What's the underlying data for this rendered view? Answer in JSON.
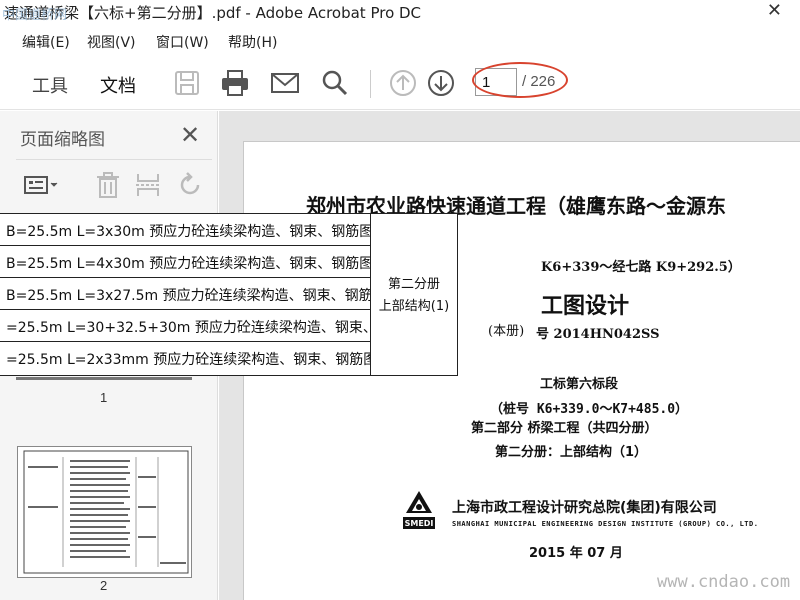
{
  "window": {
    "title": "速通道桥梁【六标+第二分册】.pdf - Adobe Acrobat Pro DC",
    "close_glyph": "✕"
  },
  "menu": [
    "编辑(E)",
    "视图(V)",
    "窗口(W)",
    "帮助(H)"
  ],
  "toolbar": {
    "tabs": [
      "工具",
      "文档"
    ],
    "active_tab": "文档",
    "page_current": "1",
    "page_total": "/ 226",
    "icons": [
      "save-icon",
      "print-icon",
      "email-icon",
      "search-icon",
      "prev-page-icon",
      "next-page-icon"
    ]
  },
  "sidebar": {
    "title": "页面缩略图",
    "close_glyph": "✕",
    "thumbnails": [
      {
        "label": "1"
      },
      {
        "label": "2"
      }
    ],
    "tools": [
      "thumbnail-options-icon",
      "delete-icon",
      "insert-icon",
      "rotate-icon"
    ]
  },
  "overlay_table": {
    "rows": [
      "B=25.5m L=3x30m  预应力砼连续梁构造、钢束、钢筋图",
      "B=25.5m L=4x30m  预应力砼连续梁构造、钢束、钢筋图",
      "B=25.5m L=3x27.5m  预应力砼连续梁构造、钢束、钢筋图",
      "=25.5m L=30+32.5+30m  预应力砼连续梁构造、钢束、钢筋图",
      "=25.5m L=2x33mm  预应力砼连续梁构造、钢束、钢筋图"
    ],
    "group_line1": "第二分册",
    "group_line2": "上部结构(1)"
  },
  "document": {
    "title": "郑州市农业路快速通道工程（雄鹰东路～金源东",
    "range": "K6+339～经七路 K9+292.5）",
    "design": "工图设计",
    "volume": "(本册)",
    "number": "号 2014HN042SS",
    "section": "工标第六标段",
    "stake": "（桩号 K6+339.0～K7+485.0）",
    "part": "第二部分  桥梁工程（共四分册）",
    "book": "第二分册：上部结构（1）",
    "org_cn": "上海市政工程设计研究总院(集团)有限公司",
    "org_en": "SHANGHAI MUNICIPAL ENGINEERING DESIGN INSTITUTE (GROUP) CO., LTD.",
    "logo_text": "SMEDI",
    "date": "2015 年 07 月"
  },
  "watermarks": {
    "top_left": "中国道桥网",
    "bottom_right": "www.cndao.com"
  },
  "colors": {
    "accent": "#2d6bcf",
    "annotation": "#d8432e"
  }
}
